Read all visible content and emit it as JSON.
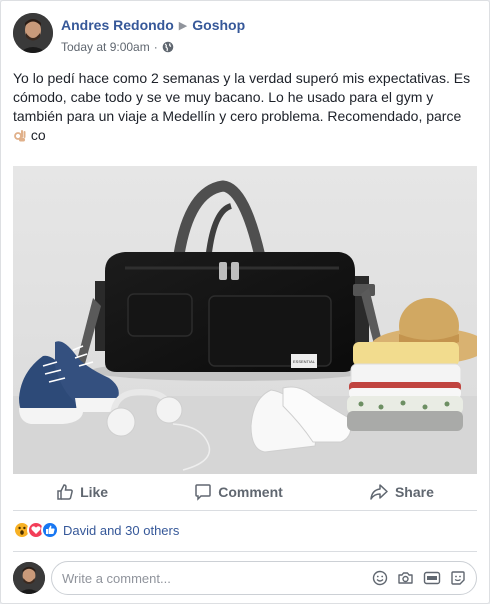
{
  "post": {
    "author": "Andres Redondo",
    "arrow": "▶",
    "group": "Goshop",
    "time": "Today at 9:00am",
    "separator": "·",
    "text": "Yo lo pedí hace como 2 semanas y la verdad superó mis expectativas. Es cómodo, cabe todo y se ve muy bacano. Lo he usado para el gym y también para un viaje a Medellín y cero problema. Recomendado, parce",
    "text_tail": "co",
    "emoji": "ok-hand-emoji"
  },
  "actions": {
    "like": "Like",
    "comment": "Comment",
    "share": "Share"
  },
  "reactions": {
    "icons": [
      "wow-icon",
      "love-icon",
      "like-icon"
    ],
    "text": "David and 30 others"
  },
  "composer": {
    "placeholder": "Write a comment...",
    "icons": [
      "emoji-icon",
      "camera-icon",
      "gif-icon",
      "sticker-icon"
    ]
  },
  "photo": {
    "label_text": "ESSENTIAL",
    "colors": {
      "bag": "#111111",
      "strap": "#555555"
    }
  },
  "colors": {
    "link": "#365899",
    "muted": "#606770",
    "like_blue": "#1877f2"
  }
}
